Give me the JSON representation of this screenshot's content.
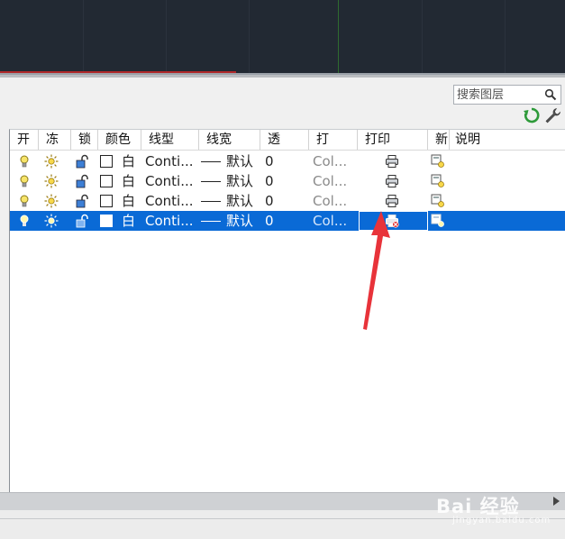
{
  "search": {
    "placeholder": "搜索图层"
  },
  "columns": [
    "开",
    "冻",
    "锁",
    "颜色",
    "线型",
    "线宽",
    "透",
    "打",
    "打印",
    "新",
    "说明"
  ],
  "layers": [
    {
      "color_label": "白",
      "linetype": "Conti...",
      "lineweight": "默认",
      "transparency": "0",
      "plot_style": "Col...",
      "selected": false
    },
    {
      "color_label": "白",
      "linetype": "Conti...",
      "lineweight": "默认",
      "transparency": "0",
      "plot_style": "Col...",
      "selected": false
    },
    {
      "color_label": "白",
      "linetype": "Conti...",
      "lineweight": "默认",
      "transparency": "0",
      "plot_style": "Col...",
      "selected": false
    },
    {
      "color_label": "白",
      "linetype": "Conti...",
      "lineweight": "默认",
      "transparency": "0",
      "plot_style": "Col...",
      "selected": true
    }
  ],
  "icons": {
    "on": "lightbulb-icon",
    "freeze": "sun-icon",
    "lock": "unlock-icon",
    "plot": "printer-icon",
    "plot_disabled": "printer-no-plot-icon",
    "new_vp_freeze": "new-viewport-freeze-icon",
    "refresh": "refresh-icon",
    "settings": "wrench-icon",
    "search": "magnifier-icon"
  },
  "watermark": {
    "text": "Bai 经验",
    "sub": "jingyan.baidu.com"
  },
  "colors": {
    "selection": "#0a6ad6",
    "canvas_bg": "#222933",
    "annotation_arrow": "#e8333a"
  }
}
